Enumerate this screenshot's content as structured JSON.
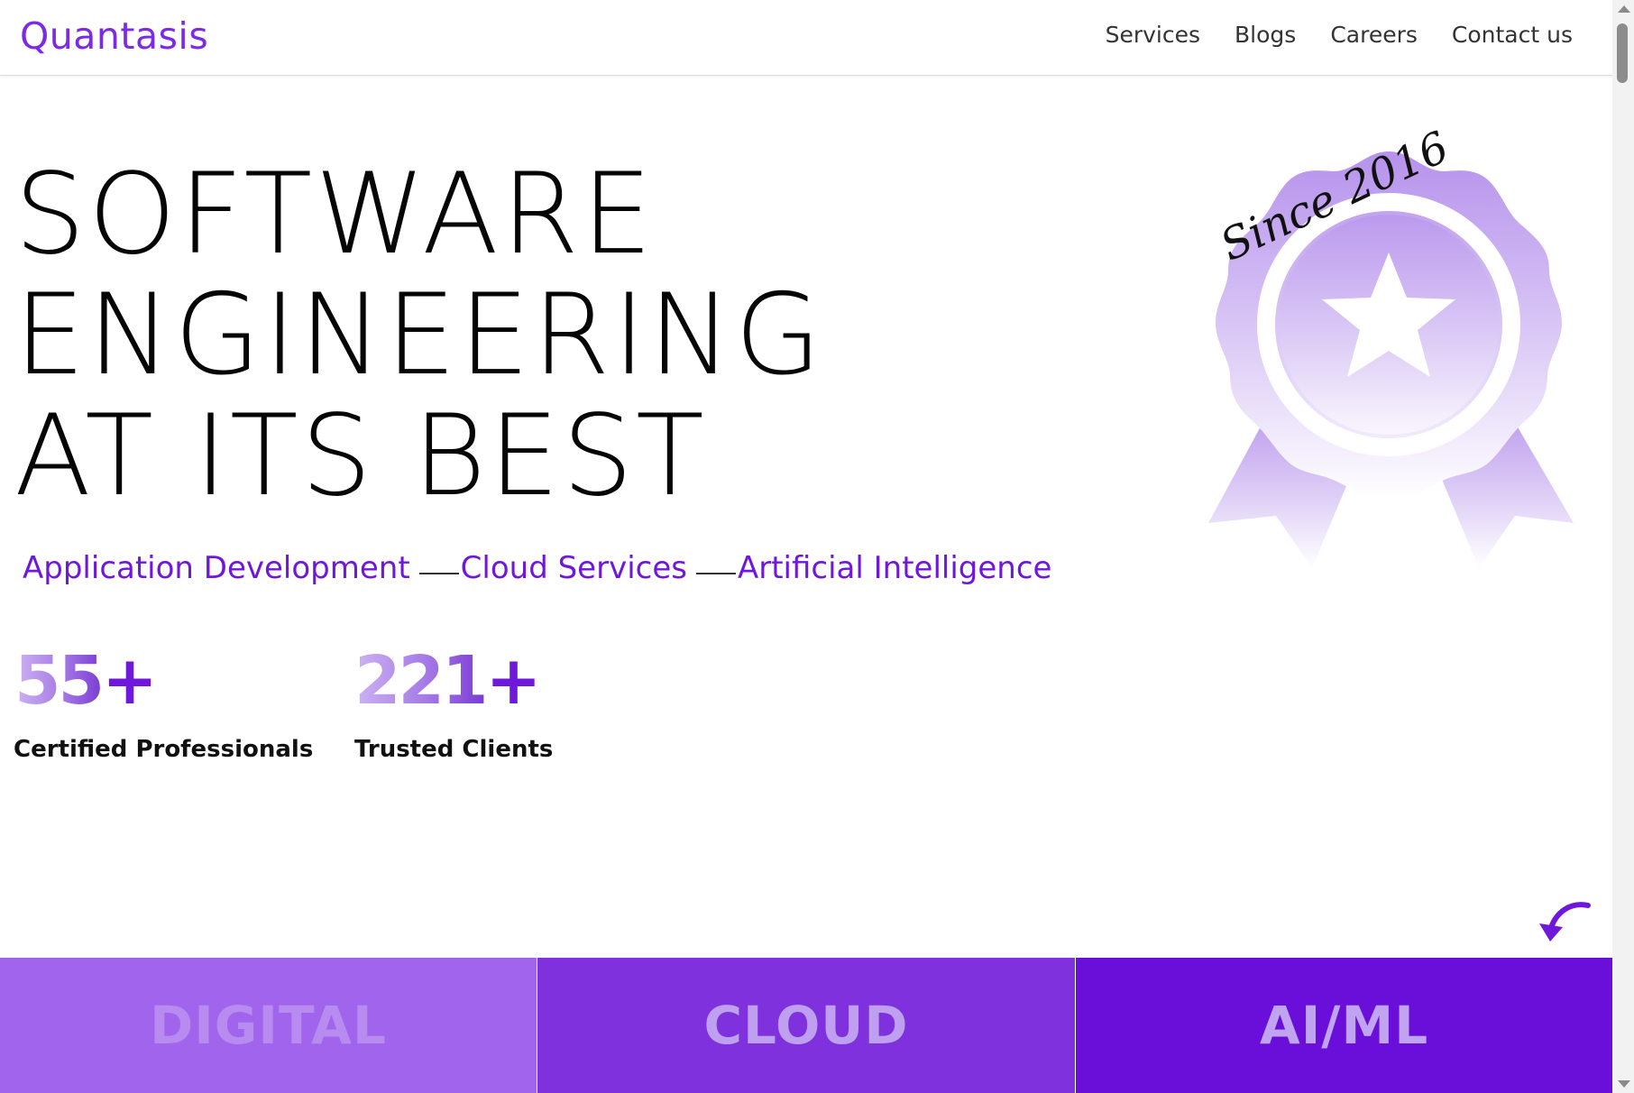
{
  "header": {
    "logo": "Quantasis",
    "nav": [
      "Services",
      "Blogs",
      "Careers",
      "Contact us"
    ]
  },
  "hero": {
    "line1": "SOFTWARE",
    "line2": "ENGINEERING",
    "line3": "AT ITS BEST",
    "subtitle": [
      "Application Development",
      "Cloud Services",
      "Artificial Intelligence"
    ],
    "badge_text": "Since 2016",
    "badge_icon": "award-ribbon-star-icon"
  },
  "stats": [
    {
      "number": "55",
      "suffix": "+",
      "label": "Certified Professionals"
    },
    {
      "number": "221",
      "suffix": "+",
      "label": "Trusted Clients"
    }
  ],
  "scroll_hint_icon": "curved-arrow-down-icon",
  "tiles": [
    "DIGITAL",
    "CLOUD",
    "AI/ML"
  ],
  "colors": {
    "brand": "#7c2ae8",
    "accent": "#6f17db",
    "tile_digital": "#a065ec",
    "tile_cloud": "#7e31dc",
    "tile_aiml": "#6a0fd9"
  }
}
